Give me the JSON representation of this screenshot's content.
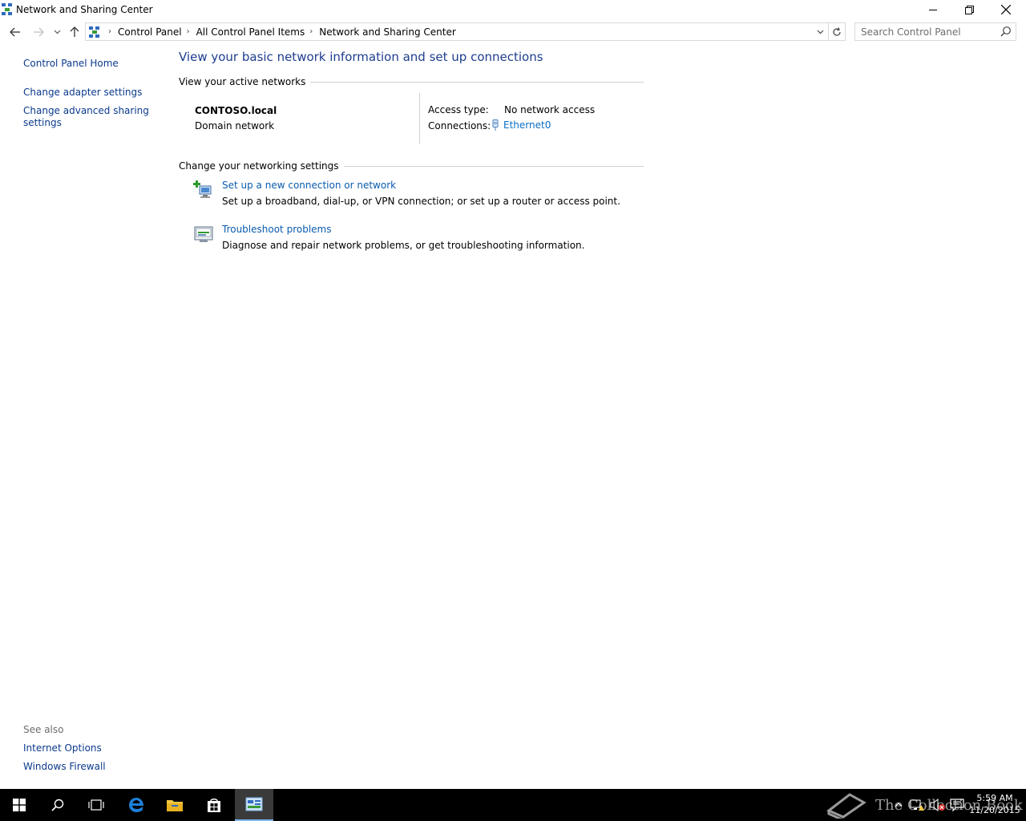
{
  "window": {
    "title": "Network and Sharing Center"
  },
  "address_bar": {
    "crumbs": [
      "Control Panel",
      "All Control Panel Items",
      "Network and Sharing Center"
    ]
  },
  "search": {
    "placeholder": "Search Control Panel"
  },
  "left_pane": {
    "home": "Control Panel Home",
    "adapter": "Change adapter settings",
    "advanced": "Change advanced sharing settings",
    "see_also_label": "See also",
    "see_also": [
      "Internet Options",
      "Windows Firewall"
    ]
  },
  "main": {
    "title": "View your basic network information and set up connections",
    "active_networks_heading": "View your active networks",
    "network": {
      "name": "CONTOSO.local",
      "type": "Domain network",
      "access_type_label": "Access type:",
      "access_type_value": "No network access",
      "connections_label": "Connections:",
      "connection_name": "Ethernet0"
    },
    "change_settings_heading": "Change your networking settings",
    "tasks": [
      {
        "link": "Set up a new connection or network",
        "desc": "Set up a broadband, dial-up, or VPN connection; or set up a router or access point."
      },
      {
        "link": "Troubleshoot problems",
        "desc": "Diagnose and repair network problems, or get troubleshooting information."
      }
    ]
  },
  "taskbar": {
    "watermark": "The Collection Book",
    "clock_time": "5:59 AM",
    "clock_date": "11/20/2015"
  },
  "colors": {
    "link": "#0b3a8c",
    "title": "#1e3d8f",
    "taskbar": "#000000"
  }
}
